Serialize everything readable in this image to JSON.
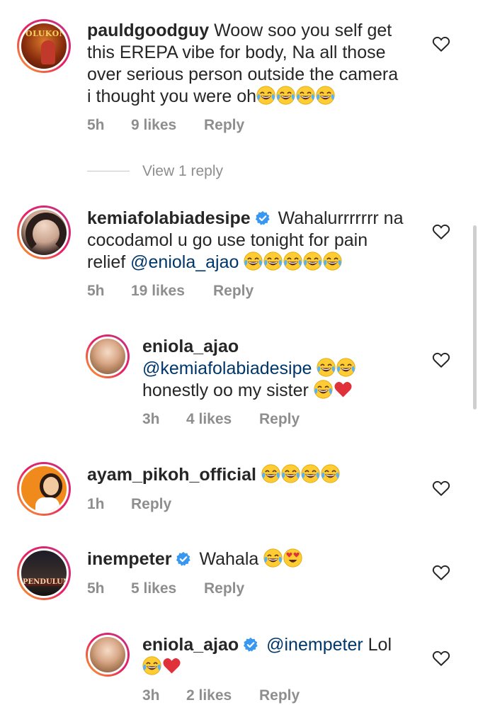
{
  "icons": {
    "like": "heart-outline-icon",
    "verified": "verified-badge-icon",
    "laugh": "face-with-tears-of-joy-emoji",
    "red_heart": "red-heart-emoji",
    "heart_eyes": "heart-eyes-emoji"
  },
  "colors": {
    "mention": "#00376b",
    "meta": "#8e8e8e",
    "verified": "#3897f0"
  },
  "comments": [
    {
      "username": "pauldgoodguy",
      "text_line1": "Woow soo you self get",
      "text_line2": "this EREPA vibe for body, Na all those",
      "text_line3": "over serious person outside the camera",
      "text_line4": "i thought you were oh",
      "time": "5h",
      "likes": "9 likes",
      "reply": "Reply",
      "avatar_text": "OLUKON",
      "view_replies": "View 1 reply"
    },
    {
      "username": "kemiafolabiadesipe",
      "text_line1": "Wahalurrrrrrr na",
      "text_line2": "cocodamol u go use tonight for pain",
      "text_line3_prefix": "relief",
      "mention": "@eniola_ajao",
      "time": "5h",
      "likes": "19 likes",
      "reply": "Reply"
    },
    {
      "username": "eniola_ajao",
      "mention": "@kemiafolabiadesipe",
      "text_line2": "honestly oo my sister",
      "time": "3h",
      "likes": "4 likes",
      "reply": "Reply"
    },
    {
      "username": "ayam_pikoh_official",
      "time": "1h",
      "reply": "Reply"
    },
    {
      "username": "inempeter",
      "text": "Wahala",
      "time": "5h",
      "likes": "5 likes",
      "reply": "Reply",
      "avatar_text": "PENDULUM"
    },
    {
      "username": "eniola_ajao",
      "mention": "@inempeter",
      "text": "Lol",
      "time": "3h",
      "likes": "2 likes",
      "reply": "Reply"
    }
  ]
}
